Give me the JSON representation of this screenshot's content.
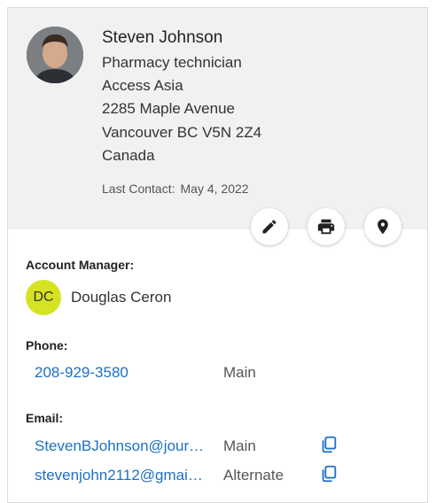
{
  "contact": {
    "name": "Steven Johnson",
    "title": "Pharmacy technician",
    "company": "Access Asia",
    "address_line1": "2285 Maple Avenue",
    "address_line2": "Vancouver BC V5N 2Z4",
    "country": "Canada",
    "last_contact_label": "Last Contact:",
    "last_contact_value": "May 4, 2022"
  },
  "actions": [
    {
      "icon": "pencil-icon"
    },
    {
      "icon": "printer-icon"
    },
    {
      "icon": "map-pin-icon"
    }
  ],
  "account_manager": {
    "label": "Account Manager:",
    "initials": "DC",
    "name": "Douglas Ceron",
    "avatar_color": "#d6e323"
  },
  "phone": {
    "label": "Phone:",
    "items": [
      {
        "value": "208-929-3580",
        "type": "Main"
      }
    ]
  },
  "email": {
    "label": "Email:",
    "items": [
      {
        "value": "StevenBJohnson@jour…",
        "type": "Main"
      },
      {
        "value": "stevenjohn2112@gmai…",
        "type": "Alternate"
      }
    ]
  },
  "colors": {
    "link": "#1e6fc4",
    "header_bg": "#f1f1f1"
  }
}
